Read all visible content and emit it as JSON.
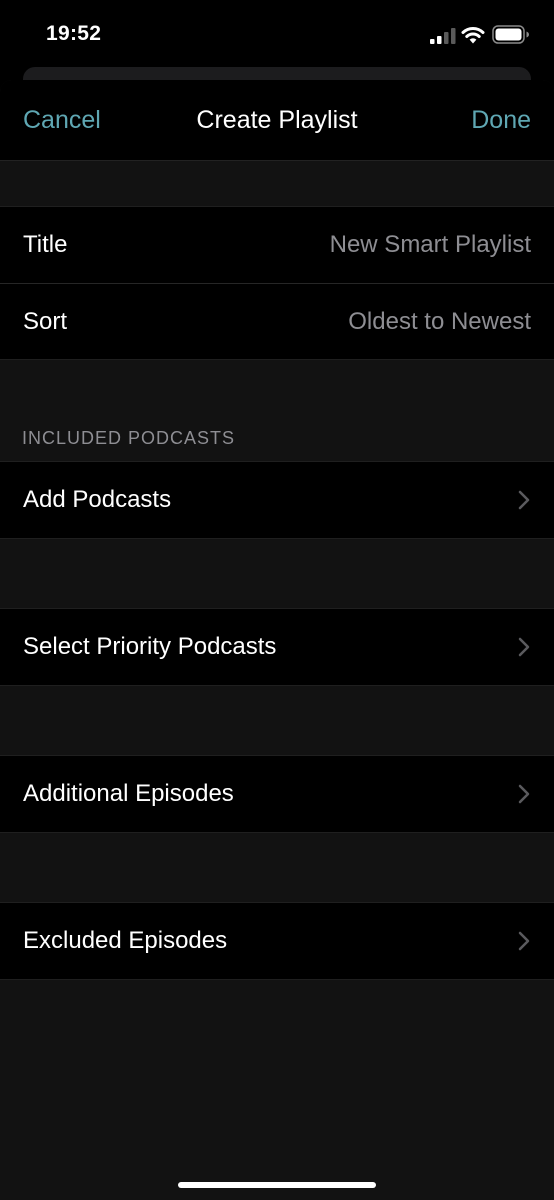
{
  "status_bar": {
    "time": "19:52"
  },
  "nav": {
    "cancel": "Cancel",
    "title": "Create Playlist",
    "done": "Done"
  },
  "settings": {
    "title_label": "Title",
    "title_value": "New Smart Playlist",
    "sort_label": "Sort",
    "sort_value": "Oldest to Newest"
  },
  "included": {
    "header": "INCLUDED PODCASTS",
    "add_podcasts": "Add Podcasts"
  },
  "priority": {
    "label": "Select Priority Podcasts"
  },
  "additional": {
    "label": "Additional Episodes"
  },
  "excluded": {
    "label": "Excluded Episodes"
  },
  "colors": {
    "accent": "#5fa7b3",
    "secondary_text": "#8e8e93",
    "background": "#000000",
    "grouped_background": "#121212"
  },
  "icons": [
    "signal-icon",
    "wifi-icon",
    "battery-icon",
    "chevron-right-icon"
  ]
}
